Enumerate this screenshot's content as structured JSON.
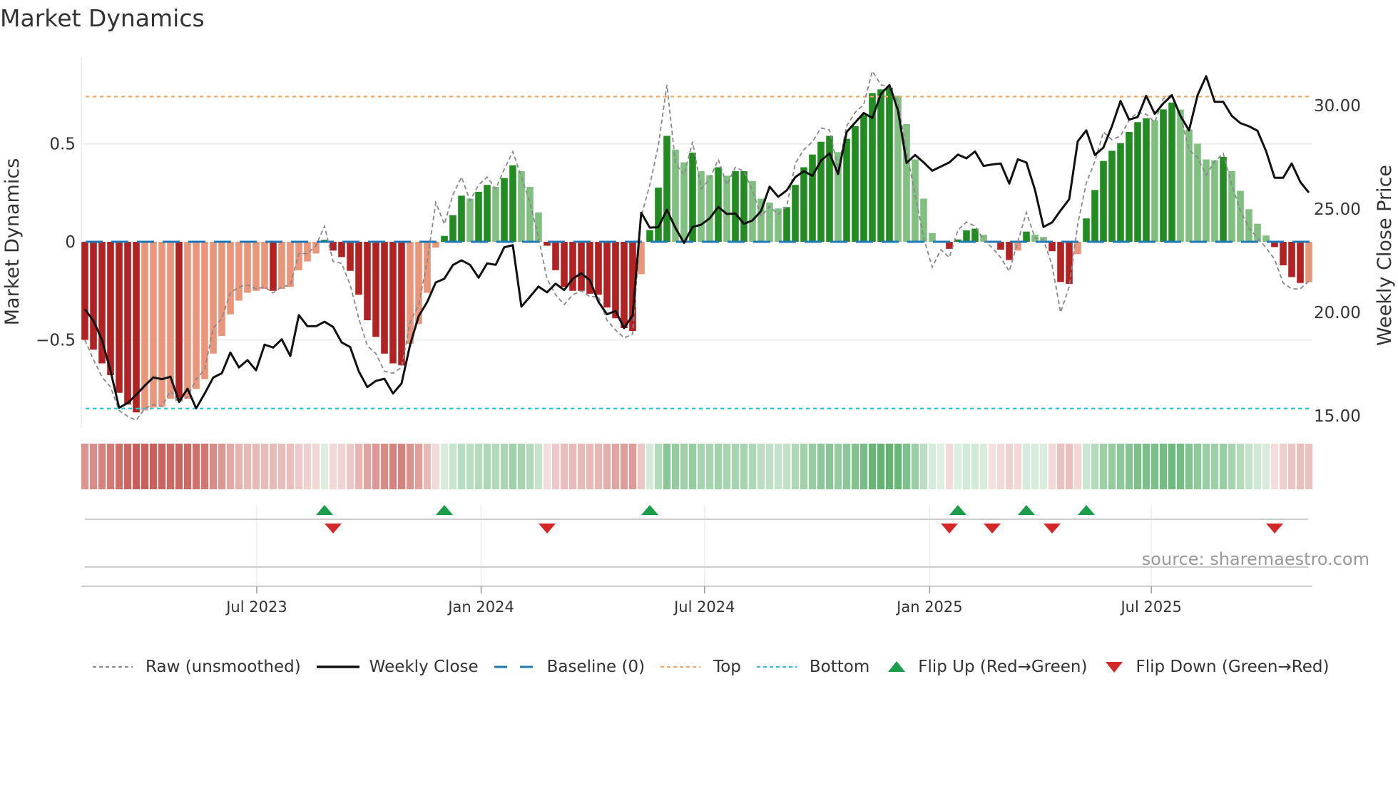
{
  "chart_data": {
    "type": "bar",
    "title": "Market Dynamics",
    "ylabel": "Market Dynamics",
    "y2label": "Weekly Close Price",
    "source": "source: sharemaestro.com",
    "ylim": [
      -0.97,
      0.97
    ],
    "y2lim": [
      13.4,
      32.6
    ],
    "yticks": [
      {
        "v": 0.5,
        "label": "0.5"
      },
      {
        "v": 0,
        "label": "0"
      },
      {
        "v": -0.5,
        "label": "−0.5"
      }
    ],
    "y2ticks": [
      {
        "v": 30,
        "label": "30.00"
      },
      {
        "v": 25,
        "label": "25.00"
      },
      {
        "v": 20,
        "label": "20.00"
      },
      {
        "v": 15,
        "label": "15.00"
      }
    ],
    "xticks": [
      {
        "week": 20.08,
        "label": "Jul 2023"
      },
      {
        "week": 46.3,
        "label": "Jan 2024"
      },
      {
        "week": 72.4,
        "label": "Jul 2024"
      },
      {
        "week": 98.7,
        "label": "Jan 2025"
      },
      {
        "week": 124.6,
        "label": "Jul 2025"
      }
    ],
    "top_level": 0.74,
    "bottom_level": -0.85,
    "baseline": 0,
    "colors": {
      "dark_red": "#b22222",
      "light_red": "#e9967a",
      "dark_green": "#228b22",
      "light_green": "#80c080",
      "raw": "#888888",
      "close": "#111111",
      "baseline": "#1f77b4",
      "top": "#f0a868",
      "bottom": "#30c0d8",
      "flip_up": "#1a9e4a",
      "flip_down": "#d62728"
    },
    "momentum": [
      -0.5,
      -0.55,
      -0.62,
      -0.68,
      -0.77,
      -0.83,
      -0.87,
      -0.86,
      -0.845,
      -0.84,
      -0.8,
      -0.81,
      -0.8,
      -0.75,
      -0.7,
      -0.57,
      -0.48,
      -0.37,
      -0.3,
      -0.26,
      -0.25,
      -0.24,
      -0.25,
      -0.24,
      -0.23,
      -0.145,
      -0.1,
      -0.06,
      0.01,
      -0.045,
      -0.078,
      -0.148,
      -0.27,
      -0.4,
      -0.485,
      -0.57,
      -0.62,
      -0.63,
      -0.52,
      -0.42,
      -0.26,
      -0.03,
      0.03,
      0.136,
      0.235,
      0.22,
      0.255,
      0.29,
      0.28,
      0.325,
      0.39,
      0.36,
      0.28,
      0.15,
      -0.02,
      -0.145,
      -0.23,
      -0.25,
      -0.25,
      -0.265,
      -0.27,
      -0.335,
      -0.39,
      -0.44,
      -0.455,
      -0.165,
      0.06,
      0.276,
      0.54,
      0.47,
      0.405,
      0.455,
      0.36,
      0.34,
      0.38,
      0.337,
      0.36,
      0.36,
      0.31,
      0.22,
      0.2,
      0.17,
      0.177,
      0.29,
      0.38,
      0.445,
      0.51,
      0.54,
      0.457,
      0.525,
      0.59,
      0.646,
      0.758,
      0.777,
      0.785,
      0.745,
      0.6,
      0.42,
      0.22,
      0.044,
      0.004,
      -0.036,
      0.012,
      0.058,
      0.067,
      0.036,
      -0.002,
      -0.04,
      -0.093,
      -0.045,
      0.052,
      0.036,
      0.025,
      -0.048,
      -0.205,
      -0.215,
      -0.063,
      0.119,
      0.264,
      0.412,
      0.464,
      0.503,
      0.56,
      0.61,
      0.63,
      0.62,
      0.675,
      0.71,
      0.674,
      0.573,
      0.5,
      0.42,
      0.416,
      0.433,
      0.36,
      0.26,
      0.166,
      0.092,
      0.032,
      -0.027,
      -0.12,
      -0.18,
      -0.21,
      -0.206
    ],
    "raw": [
      -0.5,
      -0.6,
      -0.69,
      -0.74,
      -0.86,
      -0.89,
      -0.91,
      -0.85,
      -0.83,
      -0.84,
      -0.76,
      -0.82,
      -0.79,
      -0.7,
      -0.65,
      -0.44,
      -0.39,
      -0.26,
      -0.23,
      -0.22,
      -0.24,
      -0.23,
      -0.26,
      -0.23,
      -0.22,
      -0.06,
      -0.06,
      -0.02,
      0.08,
      -0.1,
      -0.11,
      -0.22,
      -0.39,
      -0.53,
      -0.57,
      -0.66,
      -0.67,
      -0.64,
      -0.41,
      -0.32,
      -0.1,
      0.2,
      0.09,
      0.24,
      0.33,
      0.21,
      0.29,
      0.33,
      0.27,
      0.37,
      0.46,
      0.33,
      0.2,
      0.02,
      -0.19,
      -0.27,
      -0.32,
      -0.27,
      -0.25,
      -0.28,
      -0.28,
      -0.4,
      -0.45,
      -0.49,
      -0.47,
      0.13,
      0.29,
      0.49,
      0.8,
      0.4,
      0.34,
      0.51,
      0.27,
      0.32,
      0.42,
      0.29,
      0.38,
      0.36,
      0.26,
      0.13,
      0.18,
      0.14,
      0.18,
      0.4,
      0.47,
      0.51,
      0.58,
      0.57,
      0.37,
      0.59,
      0.66,
      0.7,
      0.87,
      0.8,
      0.79,
      0.71,
      0.46,
      0.24,
      0.02,
      -0.13,
      -0.04,
      -0.08,
      0.06,
      0.1,
      0.08,
      0.01,
      -0.03,
      -0.08,
      -0.15,
      0.0,
      0.15,
      0.02,
      0.01,
      -0.12,
      -0.36,
      -0.23,
      0.09,
      0.3,
      0.41,
      0.56,
      0.52,
      0.54,
      0.62,
      0.66,
      0.65,
      0.61,
      0.73,
      0.75,
      0.64,
      0.47,
      0.43,
      0.34,
      0.41,
      0.45,
      0.29,
      0.16,
      0.07,
      0.02,
      -0.03,
      -0.09,
      -0.21,
      -0.24,
      -0.24,
      -0.2
    ],
    "close": [
      20.16,
      19.59,
      18.67,
      17.17,
      15.39,
      15.62,
      16.02,
      16.46,
      16.86,
      16.77,
      16.89,
      15.68,
      16.31,
      15.36,
      16.08,
      16.85,
      17.06,
      18.06,
      17.34,
      17.69,
      17.2,
      18.44,
      18.3,
      18.7,
      17.89,
      19.87,
      19.33,
      19.33,
      19.55,
      19.3,
      18.55,
      18.32,
      17.15,
      16.39,
      16.69,
      16.79,
      16.08,
      16.57,
      18.44,
      19.82,
      20.51,
      21.45,
      21.63,
      22.29,
      22.52,
      22.3,
      21.68,
      22.37,
      22.3,
      23.15,
      23.25,
      20.28,
      20.76,
      21.25,
      20.97,
      21.39,
      21.08,
      21.63,
      21.89,
      21.55,
      20.51,
      19.91,
      20.07,
      19.24,
      19.87,
      24.82,
      24.1,
      24.12,
      24.96,
      24.08,
      23.36,
      24.13,
      24.24,
      24.55,
      25.1,
      24.76,
      24.78,
      24.28,
      24.45,
      24.9,
      26.08,
      25.59,
      25.9,
      26.54,
      26.83,
      26.6,
      27.34,
      27.69,
      26.69,
      28.72,
      29.18,
      29.64,
      29.4,
      30.56,
      30.99,
      29.76,
      27.23,
      27.61,
      27.25,
      26.85,
      27.05,
      27.25,
      27.63,
      27.45,
      27.78,
      27.08,
      27.15,
      27.2,
      26.23,
      27.4,
      27.25,
      25.93,
      24.13,
      24.35,
      24.93,
      25.47,
      28.27,
      28.8,
      27.61,
      27.97,
      29.01,
      30.22,
      29.32,
      29.44,
      30.47,
      29.6,
      30.1,
      30.5,
      29.5,
      28.8,
      30.5,
      31.42,
      30.18,
      30.18,
      29.5,
      29.15,
      29.0,
      28.78,
      27.8,
      26.51,
      26.51,
      27.2,
      26.31,
      25.79
    ],
    "flips_up": [
      28,
      42,
      66,
      102,
      110,
      117
    ],
    "flips_down": [
      29,
      54,
      101,
      106,
      113,
      139
    ],
    "legend": {
      "position": "bottom",
      "items": [
        {
          "key": "raw",
          "label": "Raw (unsmoothed)"
        },
        {
          "key": "close",
          "label": "Weekly Close"
        },
        {
          "key": "baseline",
          "label": "Baseline (0)"
        },
        {
          "key": "top",
          "label": "Top"
        },
        {
          "key": "bottom",
          "label": "Bottom"
        },
        {
          "key": "flip_up",
          "label": "Flip Up (Red→Green)"
        },
        {
          "key": "flip_down",
          "label": "Flip Down (Green→Red)"
        }
      ]
    }
  }
}
